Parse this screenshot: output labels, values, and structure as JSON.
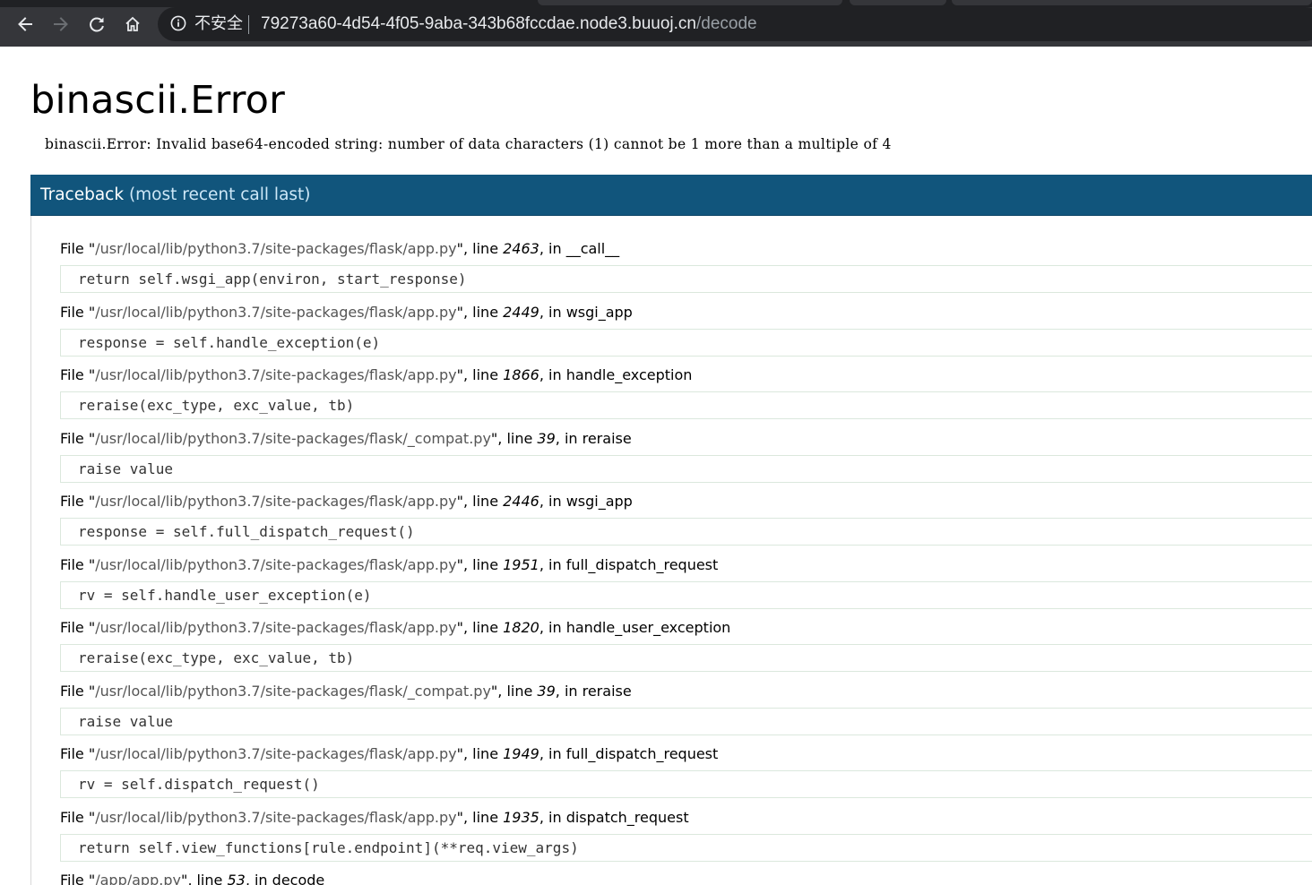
{
  "browser": {
    "security_label": "不安全",
    "url_host": "79273a60-4d54-4f05-9aba-343b68fccdae.node3.buuoj.cn",
    "url_path": "/decode"
  },
  "error": {
    "title": "binascii.Error",
    "message": "binascii.Error: Invalid base64-encoded string: number of data characters (1) cannot be 1 more than a multiple of 4"
  },
  "traceback": {
    "header": "Traceback",
    "header_note": "(most recent call last)",
    "frames": [
      {
        "file": "/usr/local/lib/python3.7/site-packages/flask/app.py",
        "line": "2463",
        "func": "__call__",
        "code": "return self.wsgi_app(environ, start_response)"
      },
      {
        "file": "/usr/local/lib/python3.7/site-packages/flask/app.py",
        "line": "2449",
        "func": "wsgi_app",
        "code": "response = self.handle_exception(e)"
      },
      {
        "file": "/usr/local/lib/python3.7/site-packages/flask/app.py",
        "line": "1866",
        "func": "handle_exception",
        "code": "reraise(exc_type, exc_value, tb)"
      },
      {
        "file": "/usr/local/lib/python3.7/site-packages/flask/_compat.py",
        "line": "39",
        "func": "reraise",
        "code": "raise value"
      },
      {
        "file": "/usr/local/lib/python3.7/site-packages/flask/app.py",
        "line": "2446",
        "func": "wsgi_app",
        "code": "response = self.full_dispatch_request()"
      },
      {
        "file": "/usr/local/lib/python3.7/site-packages/flask/app.py",
        "line": "1951",
        "func": "full_dispatch_request",
        "code": "rv = self.handle_user_exception(e)"
      },
      {
        "file": "/usr/local/lib/python3.7/site-packages/flask/app.py",
        "line": "1820",
        "func": "handle_user_exception",
        "code": "reraise(exc_type, exc_value, tb)"
      },
      {
        "file": "/usr/local/lib/python3.7/site-packages/flask/_compat.py",
        "line": "39",
        "func": "reraise",
        "code": "raise value"
      },
      {
        "file": "/usr/local/lib/python3.7/site-packages/flask/app.py",
        "line": "1949",
        "func": "full_dispatch_request",
        "code": "rv = self.dispatch_request()"
      },
      {
        "file": "/usr/local/lib/python3.7/site-packages/flask/app.py",
        "line": "1935",
        "func": "dispatch_request",
        "code": "return self.view_functions[rule.endpoint](**req.view_args)"
      },
      {
        "file": "/app/app.py",
        "line": "53",
        "func": "decode",
        "code": ""
      }
    ]
  },
  "text": {
    "file_prefix": "File \"",
    "line_word": "\", line ",
    "in_word": ", in "
  }
}
